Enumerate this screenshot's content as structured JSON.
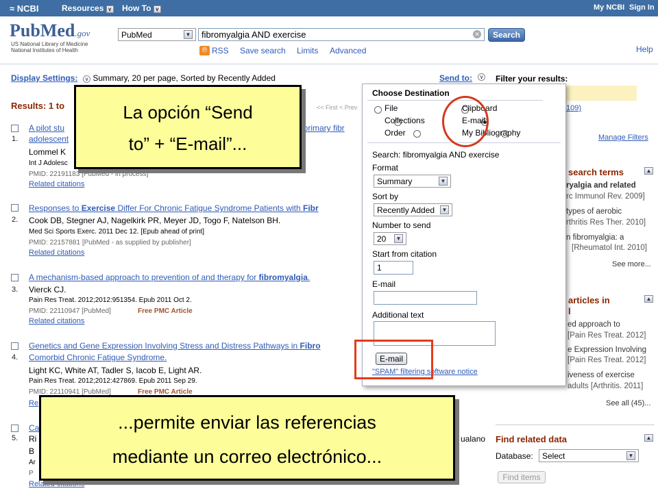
{
  "topbar": {
    "ncbi": "NCBI",
    "resources": "Resources",
    "howto": "How To",
    "mylink": "My NCBI",
    "signin": "Sign In"
  },
  "logo": {
    "pub": "Pub",
    "med": "Med",
    "gov": ".gov",
    "line1": "US National Library of Medicine",
    "line2": "National Institutes of Health"
  },
  "search": {
    "db": "PubMed",
    "query": "fibromyalgia AND exercise",
    "button": "Search"
  },
  "sublinks": {
    "rss": "RSS",
    "save": "Save search",
    "limits": "Limits",
    "advanced": "Advanced",
    "help": "Help"
  },
  "display": {
    "label": "Display Settings:",
    "value": "Summary, 20 per page, Sorted by Recently Added",
    "sendto": "Send to:"
  },
  "results": {
    "label": "Results: 1 to",
    "nav": "<< First < Prev"
  },
  "items": [
    {
      "num": "1.",
      "title_a": "A pilot stu",
      "title_b": "le primary fibr",
      "title_c": "adolescent",
      "auth": "Lommel K",
      "jnl": "Int J Adolesc",
      "pmid": "PMID: 22191183 [PubMed - in process]",
      "rel": "Related citations",
      "pmc": ""
    },
    {
      "num": "2.",
      "title_a": "Responses to ",
      "title_bold": "Exercise",
      "title_b": " Differ For Chronic Fatigue Syndrome Patients with ",
      "title_end": "Fibr",
      "auth": "Cook DB, Stegner AJ, Nagelkirk PR, Meyer JD, Togo F, Natelson BH.",
      "jnl": "Med Sci Sports Exerc. 2011 Dec 12. [Epub ahead of print]",
      "pmid": "PMID: 22157881 [PubMed - as supplied by publisher]",
      "rel": "Related citations",
      "pmc": ""
    },
    {
      "num": "3.",
      "title_a": "A mechanism-based approach to prevention of and therapy for ",
      "title_bold": "fibromyalgia",
      "title_b": ".",
      "auth": "Vierck CJ.",
      "jnl": "Pain Res Treat. 2012;2012:951354. Epub 2011 Oct 2.",
      "pmid": "PMID: 22110947 [PubMed]",
      "pmc": "Free PMC Article",
      "rel": "Related citations"
    },
    {
      "num": "4.",
      "title_a": "Genetics and Gene Expression Involving Stress and Distress Pathways in ",
      "title_bold": "Fibro",
      "title_c": "Comorbid Chronic Fatigue Syndrome.",
      "auth": "Light KC, White AT, Tadler S, Iacob E, Light AR.",
      "jnl": "Pain Res Treat. 2012;2012:427869. Epub 2011 Sep 29.",
      "pmid": "PMID: 22110941 [PubMed]",
      "pmc": "Free PMC Article",
      "rel": "Re"
    },
    {
      "num": "5.",
      "title_a": "Ca",
      "auth": "Ri",
      "auth_end": "ualano",
      "jnl": "B",
      "jnl2": "Ar",
      "pmid": "P",
      "rel": "Related citations"
    }
  ],
  "sidebar": {
    "filter_title": "Filter your results:",
    "count": "109)",
    "manage": "Manage Filters",
    "terms_head": "search terms",
    "terms": [
      "ryalgia and related",
      "rc Immunol Rev. 2009]",
      "types of aerobic",
      "rthritis Res Ther. 2010]",
      "n fibromyalgia: a",
      "[Rheumatol Int. 2010]"
    ],
    "see_more": "See more...",
    "articles_head": "articles in",
    "articles_head2": "l",
    "articles": [
      "ed approach to",
      "[Pain Res Treat. 2012]",
      "e Expression Involving",
      "[Pain Res Treat. 2012]",
      "iveness of exercise",
      "adults [Arthritis. 2011]"
    ],
    "see_all": "See all (45)...",
    "related_head": "Find related data",
    "db_label": "Database:",
    "db_value": "Select",
    "find": "Find items"
  },
  "panel": {
    "title": "Choose Destination",
    "opts": [
      "File",
      "Clipboard",
      "Collections",
      "E-mail",
      "Order",
      "My Bibliography"
    ],
    "search_line": "Search: fibromyalgia AND exercise",
    "format_label": "Format",
    "format_value": "Summary",
    "sort_label": "Sort by",
    "sort_value": "Recently Added",
    "num_label": "Number to send",
    "num_value": "20",
    "start_label": "Start from citation",
    "start_value": "1",
    "email_label": "E-mail",
    "email_value": "",
    "addtext_label": "Additional text",
    "email_button": "E-mail",
    "spam": "\"SPAM\" filtering software notice"
  },
  "callouts": {
    "top1": "La opción “Send",
    "top2": "to” + “E-mail”...",
    "bottom1": "...permite enviar las referencias",
    "bottom2": "mediante un correo electrónico..."
  },
  "colors": {
    "highlight": "#d23a1c",
    "callout_bg": "#fdfd9a",
    "topbar": "#3e6ea3"
  }
}
